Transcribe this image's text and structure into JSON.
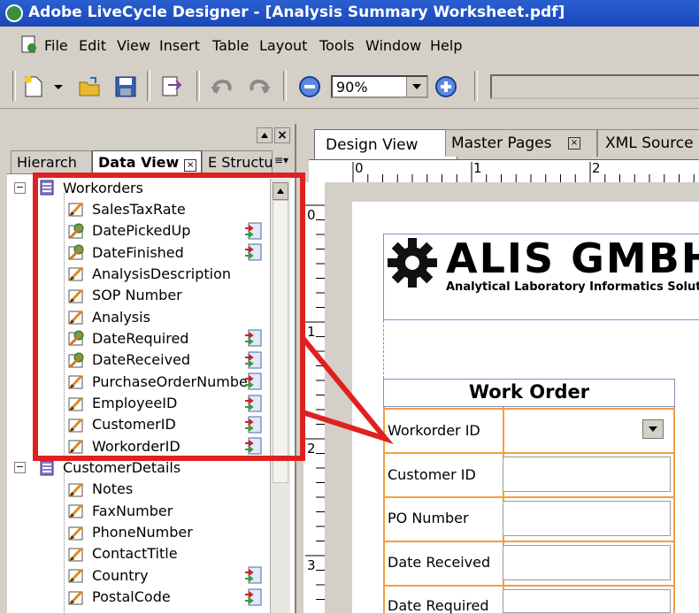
{
  "window": {
    "title": "Adobe LiveCycle Designer - [Analysis Summary Worksheet.pdf]"
  },
  "menu": {
    "items": [
      "File",
      "Edit",
      "View",
      "Insert",
      "Table",
      "Layout",
      "Tools",
      "Window",
      "Help"
    ]
  },
  "toolbar": {
    "zoom": "90%"
  },
  "left_panel": {
    "tabs": [
      "Hierarch",
      "Data View",
      "E Structu"
    ],
    "tree": [
      {
        "label": "Workorders",
        "type": "group",
        "bound": false
      },
      {
        "label": "SalesTaxRate",
        "type": "field",
        "bound": false
      },
      {
        "label": "DatePickedUp",
        "type": "date",
        "bound": true
      },
      {
        "label": "DateFinished",
        "type": "date",
        "bound": true
      },
      {
        "label": "AnalysisDescription",
        "type": "field",
        "bound": false
      },
      {
        "label": "SOP Number",
        "type": "field",
        "bound": false
      },
      {
        "label": "Analysis",
        "type": "field",
        "bound": false
      },
      {
        "label": "DateRequired",
        "type": "date",
        "bound": true
      },
      {
        "label": "DateReceived",
        "type": "date",
        "bound": true
      },
      {
        "label": "PurchaseOrderNumbe",
        "type": "field",
        "bound": true
      },
      {
        "label": "EmployeeID",
        "type": "field",
        "bound": true
      },
      {
        "label": "CustomerID",
        "type": "field",
        "bound": true
      },
      {
        "label": "WorkorderID",
        "type": "field",
        "bound": true
      },
      {
        "label": "CustomerDetails",
        "type": "group",
        "bound": false
      },
      {
        "label": "Notes",
        "type": "field",
        "bound": false
      },
      {
        "label": "FaxNumber",
        "type": "field",
        "bound": false
      },
      {
        "label": "PhoneNumber",
        "type": "field",
        "bound": false
      },
      {
        "label": "ContactTitle",
        "type": "field",
        "bound": false
      },
      {
        "label": "Country",
        "type": "field",
        "bound": true
      },
      {
        "label": "PostalCode",
        "type": "field",
        "bound": true
      }
    ]
  },
  "design": {
    "tabs": [
      "Design View",
      "Master Pages",
      "XML Source"
    ],
    "ruler_h": [
      "0",
      "1",
      "2"
    ],
    "ruler_v": [
      "0",
      "1",
      "2",
      "3"
    ],
    "logo": {
      "name": "ALIS GMBH",
      "tagline": "Analytical Laboratory Informatics Solutio"
    },
    "form_title": "Work Order",
    "fields": [
      "Workorder ID",
      "Customer ID",
      "PO Number",
      "Date Received",
      "Date Required"
    ]
  },
  "colors": {
    "highlight": "#e02020",
    "titlebar": "#1f4fc0",
    "form_border": "#f0a040"
  }
}
